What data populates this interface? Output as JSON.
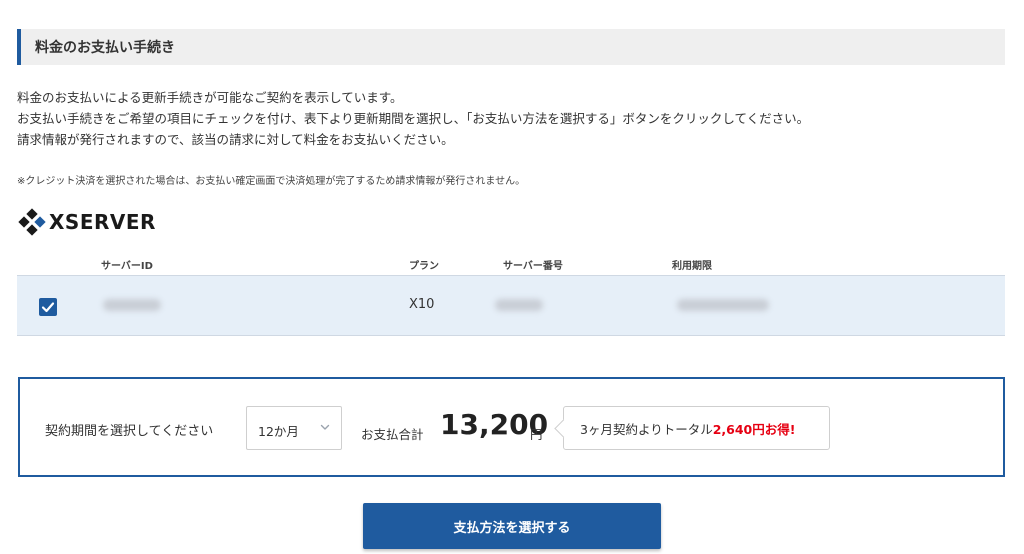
{
  "section": {
    "title": "料金のお支払い手続き"
  },
  "description": {
    "lines": [
      "料金のお支払いによる更新手続きが可能なご契約を表示しています。",
      "お支払い手続きをご希望の項目にチェックを付け、表下より更新期間を選択し、「お支払い方法を選択する」ボタンをクリックしてください。",
      "請求情報が発行されますので、該当の請求に対して料金をお支払いください。"
    ],
    "note": "※クレジット決済を選択された場合は、お支払い確定画面で決済処理が完了するため請求情報が発行されません。"
  },
  "brand": {
    "name": "XSERVER"
  },
  "table": {
    "headers": {
      "server_id": "サーバーID",
      "plan": "プラン",
      "server_number": "サーバー番号",
      "expiry": "利用期限"
    },
    "rows": [
      {
        "checked": true,
        "plan": "X10"
      }
    ]
  },
  "payment": {
    "period_label": "契約期間を選択してください",
    "period_selected": "12か月",
    "total_label": "お支払合計",
    "total_amount": "13,200",
    "total_unit": "円",
    "savings_prefix": "3ヶ月契約よりトータル",
    "savings_amount": "2,640円お得!"
  },
  "actions": {
    "select_payment_method": "支払方法を選択する"
  },
  "colors": {
    "accent": "#1f5b9f",
    "row_highlight": "#e6eff8",
    "savings_red": "#e60012"
  },
  "icons": {
    "brand": "xserver-diamond-logo-icon",
    "checkbox": "checkmark-icon",
    "select": "chevron-down-icon"
  }
}
